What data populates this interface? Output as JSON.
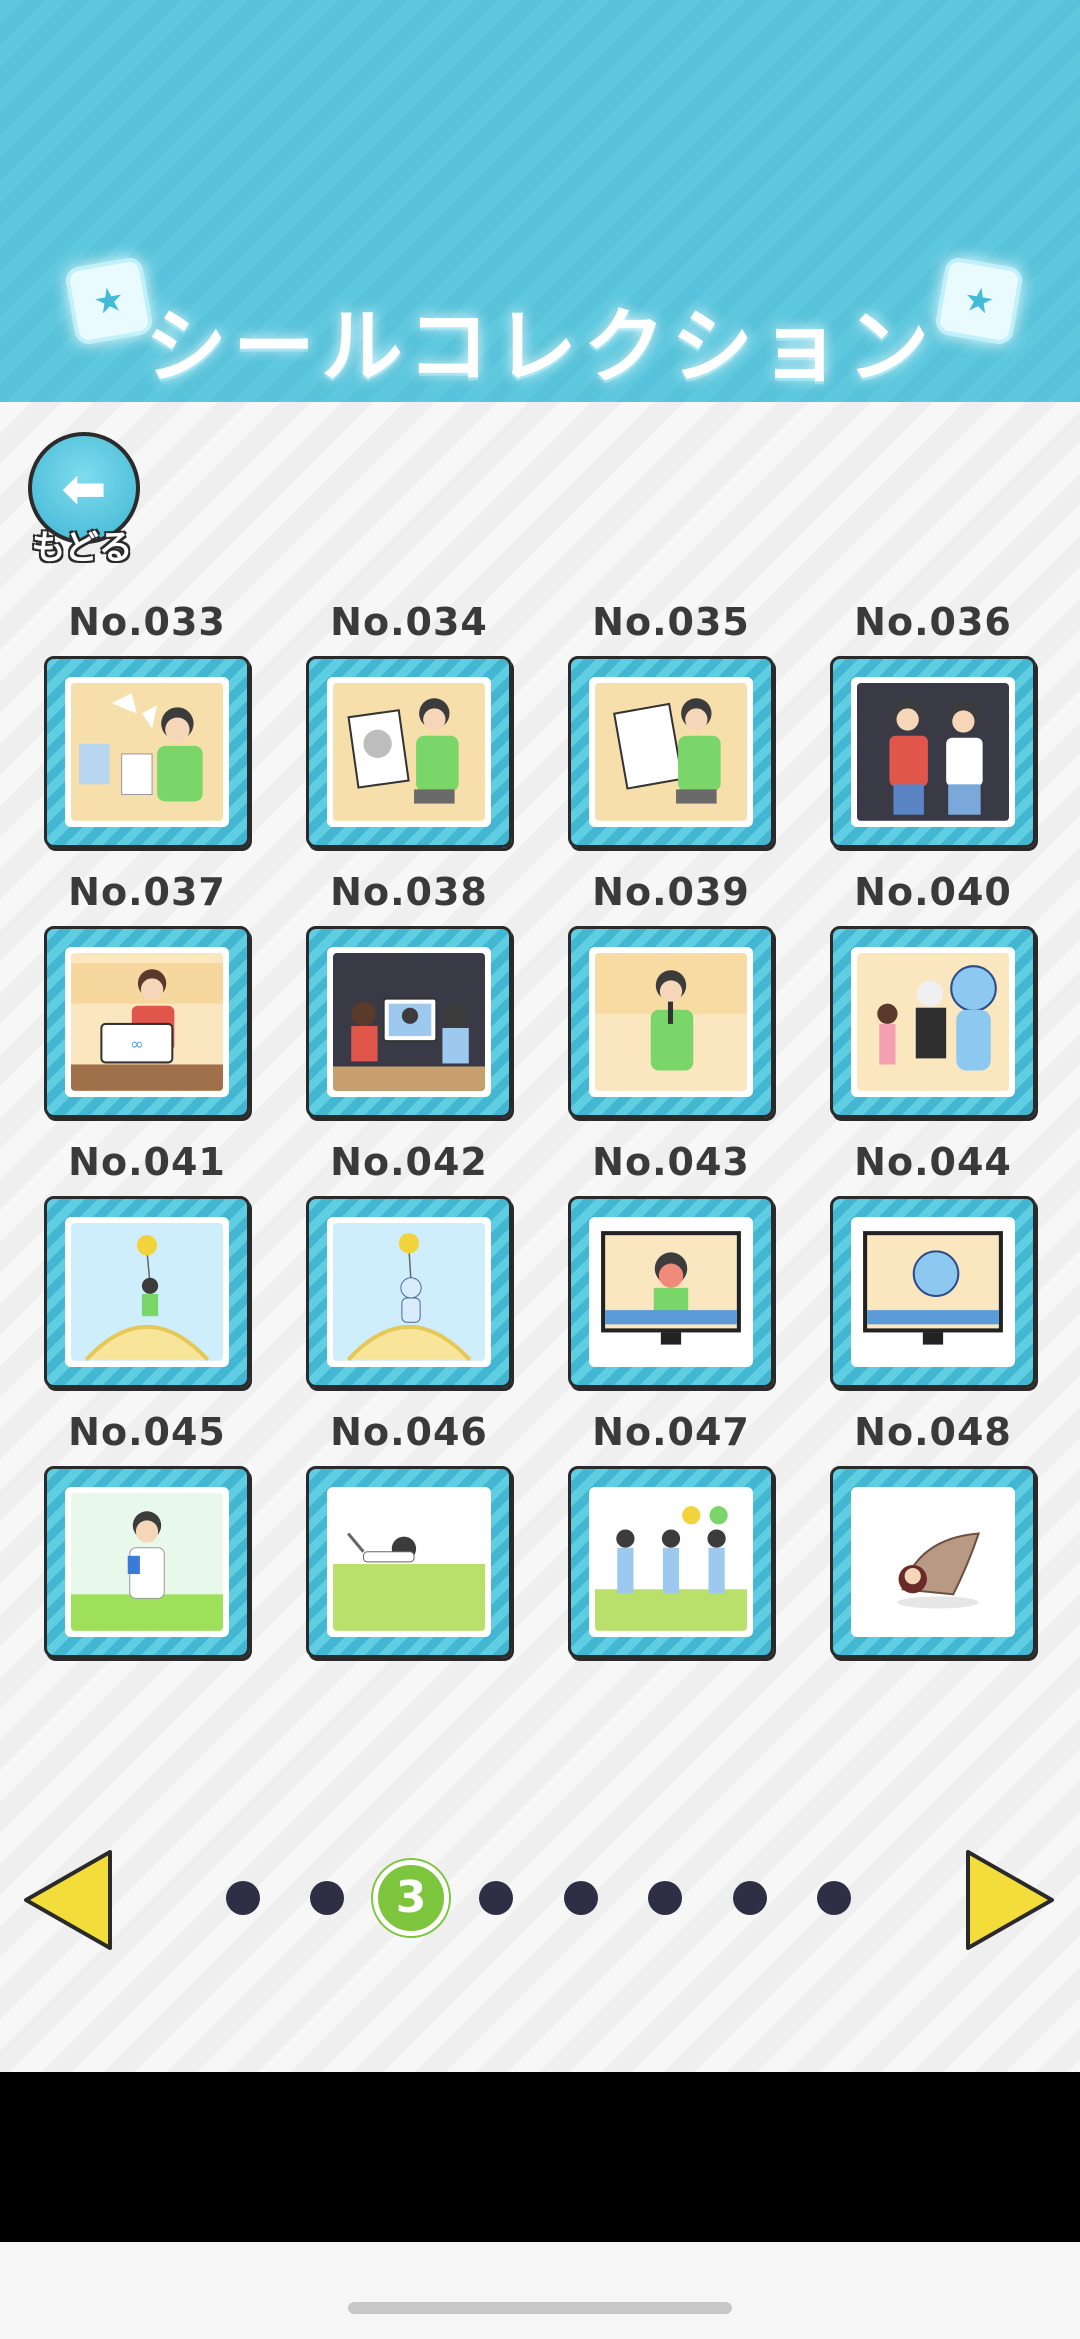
{
  "header": {
    "title": "シールコレクション"
  },
  "back_button": {
    "label": "もどる"
  },
  "stickers": [
    {
      "label": "No.033",
      "scene": "ripped-paper"
    },
    {
      "label": "No.034",
      "scene": "portrait-drawing"
    },
    {
      "label": "No.035",
      "scene": "drawing-board"
    },
    {
      "label": "No.036",
      "scene": "two-boys"
    },
    {
      "label": "No.037",
      "scene": "infinity-sign"
    },
    {
      "label": "No.038",
      "scene": "crowd-tablet"
    },
    {
      "label": "No.039",
      "scene": "microphone"
    },
    {
      "label": "No.040",
      "scene": "mascot-stage"
    },
    {
      "label": "No.041",
      "scene": "balloon-boy"
    },
    {
      "label": "No.042",
      "scene": "balloon-rabbit"
    },
    {
      "label": "No.043",
      "scene": "tv-boy"
    },
    {
      "label": "No.044",
      "scene": "tv-mascot"
    },
    {
      "label": "No.045",
      "scene": "phone-field"
    },
    {
      "label": "No.046",
      "scene": "fallen-boy"
    },
    {
      "label": "No.047",
      "scene": "dancers"
    },
    {
      "label": "No.048",
      "scene": "hermit-shell"
    }
  ],
  "pagination": {
    "current_page": "3",
    "total_pages": 8
  },
  "colors": {
    "header": "#5ec8df",
    "card_frame": "#4fc2da",
    "current_page": "#7cc53c",
    "dot": "#2e2f45",
    "arrow": "#f3dd3b"
  }
}
